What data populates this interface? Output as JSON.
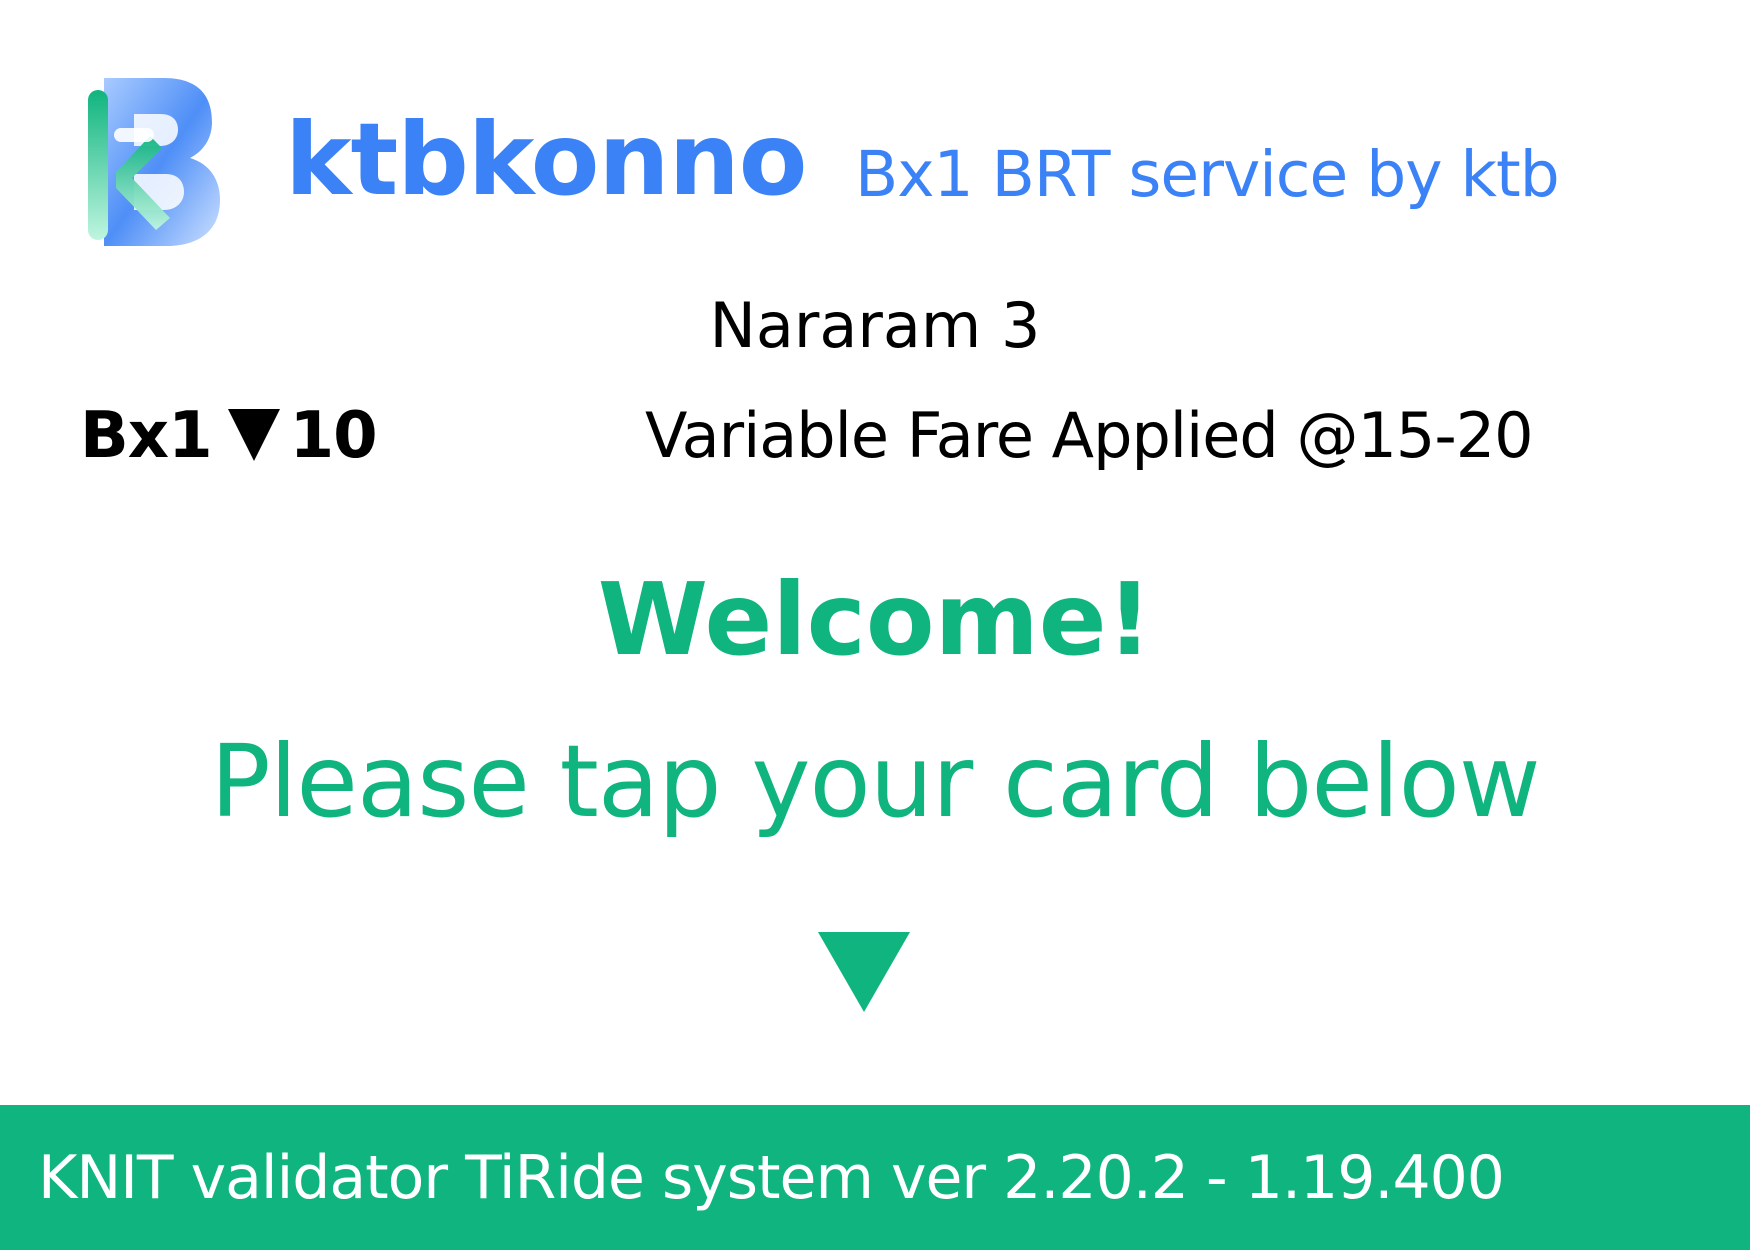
{
  "brand": {
    "name": "ktbkonno",
    "tagline": "Bx1 BRT service by ktb",
    "logo_icon": "ktb-logo-icon",
    "color": "#3b82f6"
  },
  "stop": {
    "name": "Nararam 3"
  },
  "route": {
    "line": "Bx1",
    "direction_icon": "down-triangle-icon",
    "number": "10"
  },
  "fare": {
    "text": "Variable Fare Applied @15-20"
  },
  "greeting": {
    "title": "Welcome!",
    "instruction": "Please tap your card below",
    "arrow_icon": "down-arrow-icon",
    "color": "#10b47e"
  },
  "footer": {
    "text": "KNIT validator TiRide system ver 2.20.2 - 1.19.400",
    "color": "#10b47e"
  }
}
